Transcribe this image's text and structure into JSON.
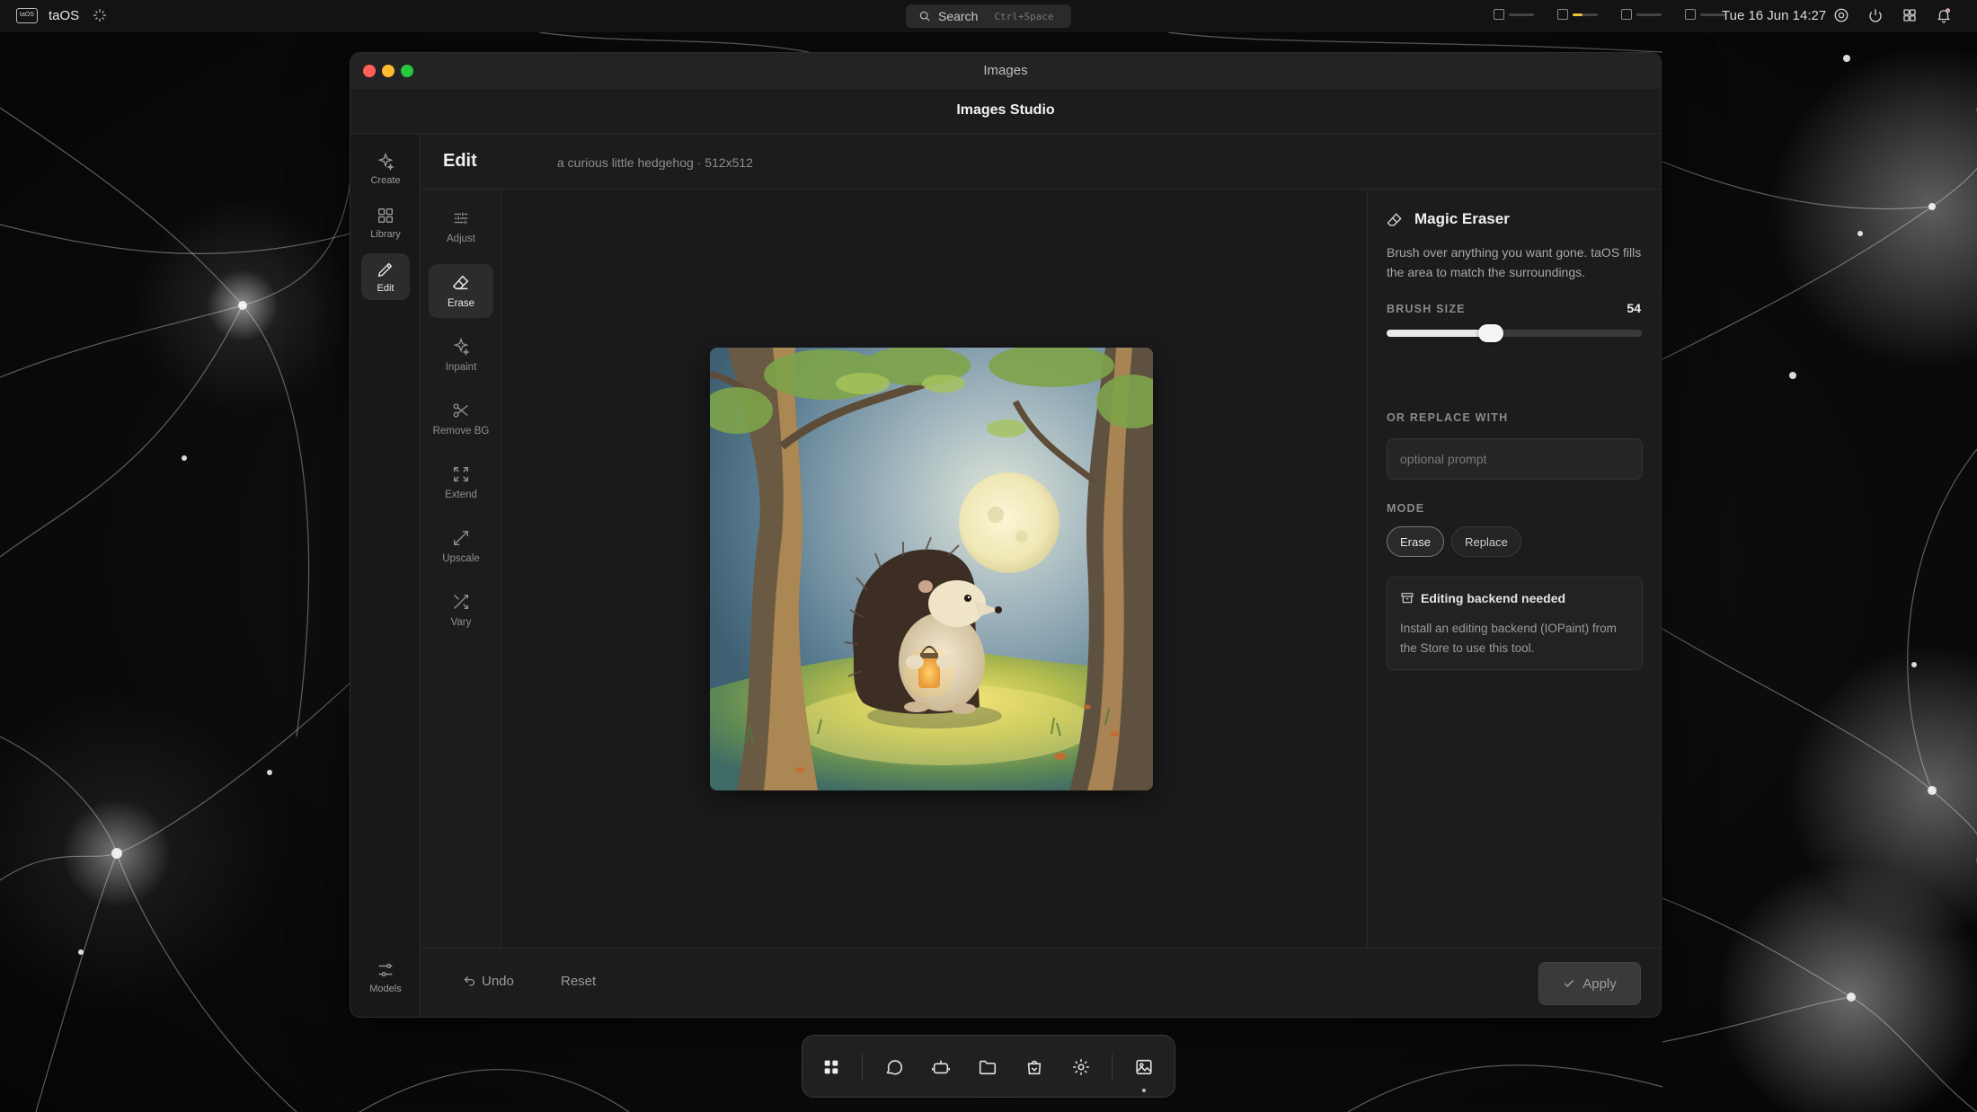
{
  "menubar": {
    "logo_text": "taOS",
    "app_name": "taOS",
    "search_placeholder": "Search",
    "search_shortcut": "Ctrl+Space",
    "clock": "Tue 16 Jun 14:27",
    "meters": [
      {
        "icon": "cpu-icon",
        "level": 0.0
      },
      {
        "icon": "memory-icon",
        "level": 0.4,
        "color": "#f0c23a"
      },
      {
        "icon": "disk-icon",
        "level": 0.0
      },
      {
        "icon": "power-icon",
        "level": 0.0
      }
    ]
  },
  "window": {
    "title": "Images",
    "studio_title": "Images Studio"
  },
  "rail": {
    "items": [
      {
        "label": "Create",
        "icon": "sparkle-icon"
      },
      {
        "label": "Library",
        "icon": "grid-icon"
      },
      {
        "label": "Edit",
        "icon": "pencil-icon",
        "active": true
      }
    ],
    "bottom": {
      "label": "Models",
      "icon": "sliders-icon"
    }
  },
  "edit": {
    "title": "Edit",
    "subtitle": "a curious little hedgehog · 512x512"
  },
  "tools": [
    {
      "label": "Adjust",
      "icon": "sliders-icon"
    },
    {
      "label": "Erase",
      "icon": "eraser-icon",
      "active": true
    },
    {
      "label": "Inpaint",
      "icon": "sparkle-icon"
    },
    {
      "label": "Remove BG",
      "icon": "scissors-icon"
    },
    {
      "label": "Extend",
      "icon": "expand-icon"
    },
    {
      "label": "Upscale",
      "icon": "arrow-diagonal-icon"
    },
    {
      "label": "Vary",
      "icon": "shuffle-icon"
    }
  ],
  "panel": {
    "title": "Magic Eraser",
    "description": "Brush over anything you want gone. taOS fills the area to match the surroundings.",
    "brush_label": "BRUSH SIZE",
    "brush_value": "54",
    "brush_fraction": 0.41,
    "replace_label": "OR REPLACE WITH",
    "replace_placeholder": "optional prompt",
    "mode_label": "MODE",
    "mode_options": [
      "Erase",
      "Replace"
    ],
    "mode_selected": "Erase",
    "notice_title": "Editing backend needed",
    "notice_body": "Install an editing backend (IOPaint) from the Store to use this tool."
  },
  "footer": {
    "undo_label": "Undo",
    "reset_label": "Reset",
    "apply_label": "Apply"
  },
  "dock": {
    "items": [
      "apps-icon",
      "chat-icon",
      "robot-icon",
      "folder-icon",
      "store-icon",
      "settings-icon",
      "image-icon"
    ]
  },
  "colors": {
    "accent_traffic_red": "#ff5f57",
    "accent_traffic_yellow": "#febc2e",
    "accent_traffic_green": "#28c840",
    "window_bg": "#1c1c1e"
  }
}
